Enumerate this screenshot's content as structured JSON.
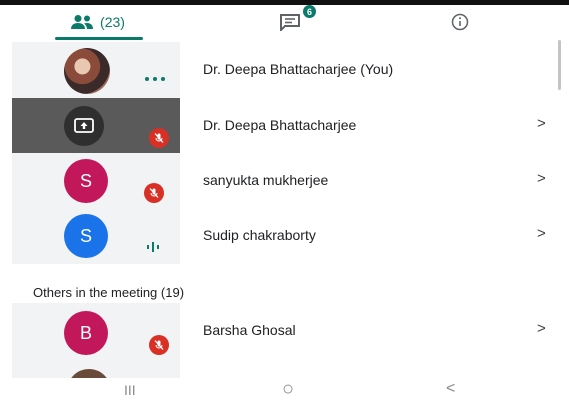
{
  "tabs": {
    "people_count": "(23)",
    "chat_badge": "6"
  },
  "participants": [
    {
      "name": "Dr. Deepa Bhattacharjee (You)",
      "status": "speaking-dots"
    },
    {
      "name": "Dr. Deepa Bhattacharjee",
      "chevron": ">",
      "status": "muted",
      "presenting": true
    },
    {
      "name": "sanyukta mukherjee",
      "initial": "S",
      "avatar_color": "#c2185b",
      "chevron": ">",
      "status": "muted"
    },
    {
      "name": "Sudip chakraborty",
      "initial": "S",
      "avatar_color": "#1a73e8",
      "chevron": ">",
      "status": "speaking-bars"
    }
  ],
  "others": {
    "heading": "Others in the meeting (19)",
    "items": [
      {
        "name": "Barsha Ghosal",
        "initial": "B",
        "avatar_color": "#c2185b",
        "chevron": ">",
        "status": "muted"
      }
    ]
  },
  "navbar": {
    "recents": "III",
    "home": "○",
    "back": "<"
  },
  "colors": {
    "accent": "#0a7a6a",
    "muted_red": "#d93025",
    "speaking_green": "#0a7a6a"
  }
}
